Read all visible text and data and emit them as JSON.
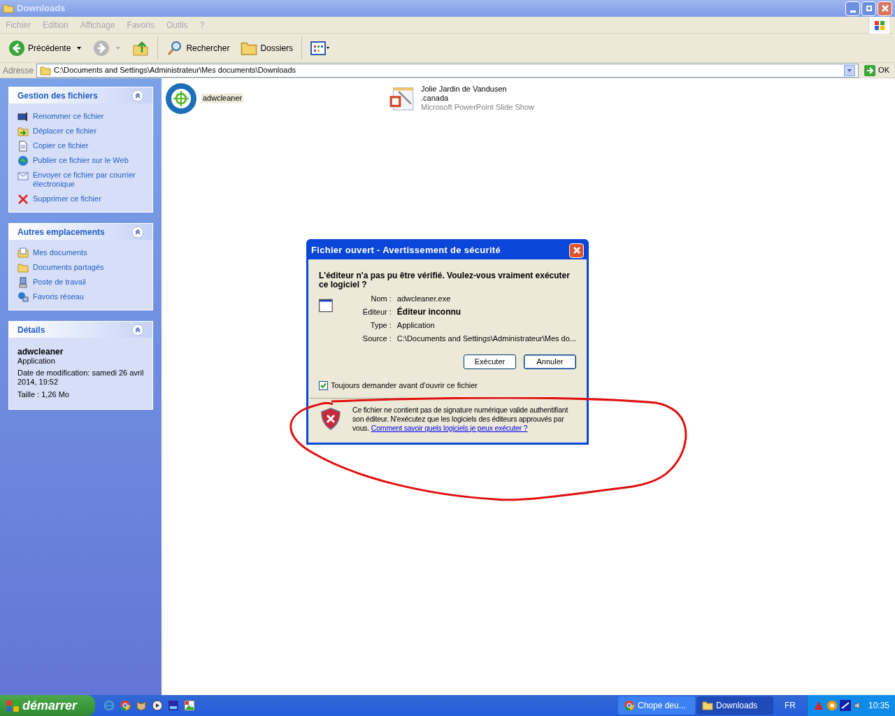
{
  "window": {
    "title": "Downloads"
  },
  "menu": [
    "Fichier",
    "Edition",
    "Affichage",
    "Favoris",
    "Outils",
    "?"
  ],
  "toolbar": [
    {
      "kind": "back",
      "label": "Précédente"
    },
    {
      "kind": "forward"
    },
    {
      "kind": "up"
    },
    {
      "kind": "search",
      "label": "Rechercher"
    },
    {
      "kind": "folders",
      "label": "Dossiers"
    },
    {
      "kind": "views"
    }
  ],
  "address": {
    "label": "Adresse",
    "value": "C:\\Documents and Settings\\Administrateur\\Mes documents\\Downloads",
    "go": "OK"
  },
  "sidebar": [
    {
      "title": "Gestion des fichiers",
      "items": [
        {
          "kind": "rename",
          "label": "Renommer ce fichier"
        },
        {
          "kind": "move",
          "label": "Déplacer ce fichier"
        },
        {
          "kind": "copy",
          "label": "Copier ce fichier"
        },
        {
          "kind": "web",
          "label": "Publier ce fichier sur le Web"
        },
        {
          "kind": "mail",
          "label": "Envoyer ce fichier par courrier électronique"
        },
        {
          "kind": "delete",
          "label": "Supprimer ce fichier"
        }
      ]
    },
    {
      "title": "Autres emplacements",
      "items": [
        {
          "kind": "docs",
          "label": "Mes documents"
        },
        {
          "kind": "folder",
          "label": "Documents partagés"
        },
        {
          "kind": "computer",
          "label": "Poste de travail"
        },
        {
          "kind": "network",
          "label": "Favoris réseau"
        }
      ]
    },
    {
      "title": "Détails",
      "details": {
        "name": "adwcleaner",
        "type": "Application",
        "date": "Date de modification: samedi 26 avril 2014, 19:52",
        "size": "Taille : 1,26 Mo"
      }
    }
  ],
  "files": [
    {
      "kind": "app",
      "name": "adwcleaner",
      "selected": true
    },
    {
      "kind": "slideshow",
      "name": "Jolie Jardin de Vandusen .canada",
      "type": "Microsoft PowerPoint Slide Show",
      "selected": false
    }
  ],
  "dialog": {
    "title": "Fichier ouvert - Avertissement de sécurité",
    "question": "L'éditeur n'a pas pu être vérifié. Voulez-vous vraiment exécuter ce logiciel ?",
    "fields": [
      {
        "label": "Nom :",
        "value": "adwcleaner.exe",
        "bold": false
      },
      {
        "label": "Éditeur :",
        "value": "Éditeur inconnu",
        "bold": true
      },
      {
        "label": "Type :",
        "value": "Application",
        "bold": false
      },
      {
        "label": "Source :",
        "value": "C:\\Documents and Settings\\Administrateur\\Mes do...",
        "bold": false
      }
    ],
    "buttons": [
      {
        "label": "Exécuter",
        "default": false
      },
      {
        "label": "Annuler",
        "default": true
      }
    ],
    "checkbox": {
      "label": "Toujours demander avant d'ouvrir ce fichier",
      "checked": true
    },
    "warning": "Ce fichier ne contient pas de signature numérique valide authentifiant son éditeur. N'exécutez que les logiciels des éditeurs approuvés par vous.",
    "link": "Comment savoir quels logiciels je peux exécuter ?"
  },
  "taskbar": {
    "start": "démarrer",
    "quicklaunch": [
      {
        "kind": "ie"
      },
      {
        "kind": "chrome"
      },
      {
        "kind": "cat"
      },
      {
        "kind": "player"
      },
      {
        "kind": "xsat"
      },
      {
        "kind": "paint"
      }
    ],
    "tasks": [
      {
        "kind": "browser",
        "label": "Chope deu...",
        "selected": false
      },
      {
        "kind": "folder",
        "label": "Downloads",
        "selected": true
      }
    ],
    "lang": "FR",
    "time": "10:35"
  }
}
